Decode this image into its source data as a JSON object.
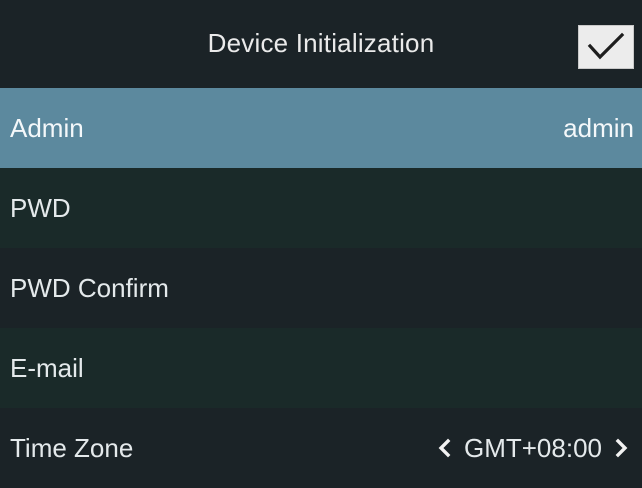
{
  "header": {
    "title": "Device Initialization",
    "confirm_icon": "check-icon"
  },
  "rows": {
    "admin": {
      "label": "Admin",
      "value": "admin"
    },
    "pwd": {
      "label": "PWD",
      "value": ""
    },
    "pwd_confirm": {
      "label": "PWD Confirm",
      "value": ""
    },
    "email": {
      "label": "E-mail",
      "value": ""
    },
    "time_zone": {
      "label": "Time Zone",
      "value": "GMT+08:00",
      "prev_icon": "chevron-left-icon",
      "next_icon": "chevron-right-icon"
    }
  },
  "colors": {
    "background": "#1a2226",
    "selected_row": "#5c899e",
    "alt_row": "#1a2a29",
    "text": "#e4e9eb",
    "confirm_button": "#ececec"
  }
}
